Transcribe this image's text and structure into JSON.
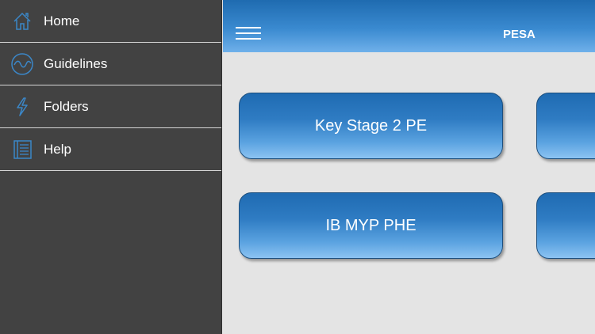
{
  "sidebar": {
    "items": [
      {
        "label": "Home",
        "icon": "home-icon"
      },
      {
        "label": "Guidelines",
        "icon": "wave-circle-icon"
      },
      {
        "label": "Folders",
        "icon": "lightning-icon"
      },
      {
        "label": "Help",
        "icon": "document-list-icon"
      }
    ]
  },
  "header": {
    "title": "PESA",
    "menu_icon": "hamburger-menu-icon"
  },
  "main": {
    "cards": [
      {
        "label": "Key Stage 2 PE"
      },
      {
        "label": ""
      },
      {
        "label": "IB MYP PHE"
      },
      {
        "label": ""
      }
    ]
  },
  "colors": {
    "sidebar_bg": "#424242",
    "accent_blue": "#2f7cc3",
    "content_bg": "#e4e4e4",
    "icon_blue": "#3b87c8"
  }
}
